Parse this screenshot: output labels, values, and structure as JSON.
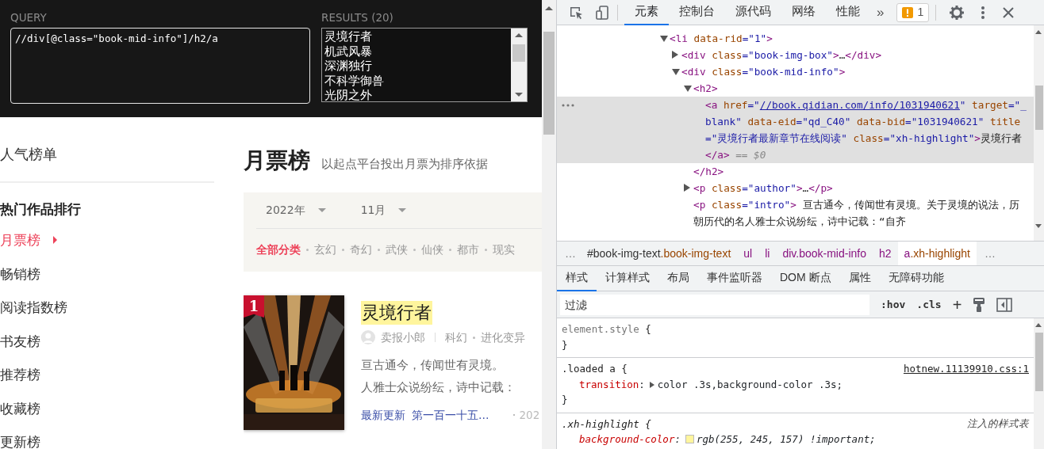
{
  "query_panel": {
    "query_label": "QUERY",
    "query": "//div[@class=\"book-mid-info\"]/h2/a",
    "results_label": "RESULTS (20)",
    "results": [
      "灵境行者",
      "机武风暴",
      "深渊独行",
      "不科学御兽",
      "光阴之外"
    ]
  },
  "page": {
    "sidebar": {
      "header": "人气榜单",
      "section_title": "热门作品排行",
      "items": [
        {
          "label": "月票榜",
          "selected": true
        },
        {
          "label": "畅销榜",
          "selected": false
        },
        {
          "label": "阅读指数榜",
          "selected": false
        },
        {
          "label": "书友榜",
          "selected": false
        },
        {
          "label": "推荐榜",
          "selected": false
        },
        {
          "label": "收藏榜",
          "selected": false
        },
        {
          "label": "更新榜",
          "selected": false
        }
      ]
    },
    "ranking": {
      "title": "月票榜",
      "subtitle": "以起点平台投出月票为排序依据",
      "year": "2022年",
      "month": "11月",
      "categories": [
        {
          "label": "全部分类",
          "selected": true
        },
        {
          "label": "玄幻",
          "selected": false
        },
        {
          "label": "奇幻",
          "selected": false
        },
        {
          "label": "武侠",
          "selected": false
        },
        {
          "label": "仙侠",
          "selected": false
        },
        {
          "label": "都市",
          "selected": false
        },
        {
          "label": "现实",
          "selected": false
        }
      ]
    },
    "book": {
      "rank": "1",
      "title": "灵境行者",
      "highlighted": true,
      "author": "卖报小郎",
      "genre": "科幻",
      "subgenre": "进化变异",
      "intro_lines": [
        "亘古通今，传闻世有灵境。",
        "人雅士众说纷纭，诗中记载："
      ],
      "latest_label": "最新更新",
      "latest_chapter": "第一百一十五…",
      "date": "202"
    }
  },
  "devtools": {
    "tabs": [
      {
        "label": "元素",
        "selected": true
      },
      {
        "label": "控制台",
        "selected": false
      },
      {
        "label": "源代码",
        "selected": false
      },
      {
        "label": "网络",
        "selected": false
      },
      {
        "label": "性能",
        "selected": false
      }
    ],
    "more": "»",
    "issues": "1",
    "dom_tree": [
      {
        "expanded": true,
        "selected": false,
        "segments": [
          {
            "kind": "tag",
            "text": "<li"
          },
          {
            "kind": "attr",
            "text": " data-rid"
          },
          {
            "kind": "val",
            "text": "=\"1\""
          },
          {
            "kind": "tag",
            "text": ">"
          }
        ],
        "children": [
          {
            "expanded": false,
            "selected": false,
            "segments": [
              {
                "kind": "tag",
                "text": "<div"
              },
              {
                "kind": "attr",
                "text": " class"
              },
              {
                "kind": "val",
                "text": "=\"book-img-box\""
              },
              {
                "kind": "tag",
                "text": ">"
              },
              {
                "kind": "text",
                "text": "…"
              },
              {
                "kind": "tag",
                "text": "</div>"
              }
            ]
          },
          {
            "expanded": true,
            "selected": false,
            "segments": [
              {
                "kind": "tag",
                "text": "<div"
              },
              {
                "kind": "attr",
                "text": " class"
              },
              {
                "kind": "val",
                "text": "=\"book-mid-info\""
              },
              {
                "kind": "tag",
                "text": ">"
              }
            ],
            "children": [
              {
                "expanded": true,
                "selected": false,
                "segments": [
                  {
                    "kind": "tag",
                    "text": "<h2>"
                  }
                ],
                "close": [
                  {
                    "kind": "tag",
                    "text": "</h2>"
                  }
                ],
                "children": [
                  {
                    "selected": true,
                    "segments": [
                      {
                        "kind": "tag",
                        "text": "<a"
                      },
                      {
                        "kind": "attr",
                        "text": " href"
                      },
                      {
                        "kind": "val",
                        "text": "=\""
                      },
                      {
                        "kind": "link",
                        "text": "//book.qidian.com/info/1031940621"
                      },
                      {
                        "kind": "val",
                        "text": "\""
                      },
                      {
                        "kind": "attr",
                        "text": " target"
                      },
                      {
                        "kind": "val",
                        "text": "=\"_blank\""
                      },
                      {
                        "kind": "attr",
                        "text": " data-eid"
                      },
                      {
                        "kind": "val",
                        "text": "=\"qd_C40\""
                      },
                      {
                        "kind": "attr",
                        "text": " data-bid"
                      },
                      {
                        "kind": "val",
                        "text": "=\"1031940621\""
                      },
                      {
                        "kind": "attr",
                        "text": " title"
                      },
                      {
                        "kind": "val",
                        "text": "=\"灵境行者最新章节在线阅读\""
                      },
                      {
                        "kind": "attr",
                        "text": " class"
                      },
                      {
                        "kind": "val",
                        "text": "=\"xh-highlight\""
                      },
                      {
                        "kind": "tag",
                        "text": ">"
                      },
                      {
                        "kind": "text",
                        "text": "灵境行者"
                      },
                      {
                        "kind": "tag",
                        "text": "</a>"
                      },
                      {
                        "kind": "hint",
                        "text": " == $0"
                      }
                    ]
                  }
                ]
              },
              {
                "expanded": false,
                "selected": false,
                "segments": [
                  {
                    "kind": "tag",
                    "text": "<p"
                  },
                  {
                    "kind": "attr",
                    "text": " class"
                  },
                  {
                    "kind": "val",
                    "text": "=\"author\""
                  },
                  {
                    "kind": "tag",
                    "text": ">"
                  },
                  {
                    "kind": "text",
                    "text": "…"
                  },
                  {
                    "kind": "tag",
                    "text": "</p>"
                  }
                ]
              },
              {
                "selected": false,
                "segments": [
                  {
                    "kind": "tag",
                    "text": "<p"
                  },
                  {
                    "kind": "attr",
                    "text": " class"
                  },
                  {
                    "kind": "val",
                    "text": "=\"intro\""
                  },
                  {
                    "kind": "tag",
                    "text": ">"
                  },
                  {
                    "kind": "text",
                    "text": " 亘古通今，传闻世有灵境。关于灵境的说法，历朝历代的名人雅士众说纷纭，诗中记载：“自齐"
                  }
                ]
              }
            ]
          }
        ]
      }
    ],
    "breadcrumb": {
      "leading": "…",
      "trailing": "…",
      "items": [
        {
          "selected": false,
          "parts": [
            {
              "kind": "id",
              "text": "#book-img-text"
            },
            {
              "kind": "cls",
              "text": ".book-img-text"
            }
          ]
        },
        {
          "selected": false,
          "parts": [
            {
              "kind": "tag",
              "text": "ul"
            }
          ]
        },
        {
          "selected": false,
          "parts": [
            {
              "kind": "tag",
              "text": "li"
            }
          ]
        },
        {
          "selected": false,
          "parts": [
            {
              "kind": "tag",
              "text": "div.book-mid-info"
            }
          ]
        },
        {
          "selected": false,
          "parts": [
            {
              "kind": "tag",
              "text": "h2"
            }
          ]
        },
        {
          "selected": true,
          "parts": [
            {
              "kind": "tag",
              "text": "a"
            },
            {
              "kind": "cls",
              "text": ".xh-highlight"
            }
          ]
        }
      ]
    },
    "styles_tabs": [
      {
        "label": "样式",
        "selected": true
      },
      {
        "label": "计算样式",
        "selected": false
      },
      {
        "label": "布局",
        "selected": false
      },
      {
        "label": "事件监听器",
        "selected": false
      },
      {
        "label": "DOM 断点",
        "selected": false
      },
      {
        "label": "属性",
        "selected": false
      },
      {
        "label": "无障碍功能",
        "selected": false
      }
    ],
    "filter": {
      "placeholder": "过滤",
      "hov": ":hov",
      "cls": ".cls",
      "add": "+"
    },
    "rules": [
      {
        "selector": "element.style",
        "kind": "inline",
        "open": "{",
        "close": "}"
      },
      {
        "selector": ".loaded a",
        "kind": "stylesheet",
        "source": "hotnew.11139910.css:1",
        "open": "{",
        "close": "}",
        "declarations": [
          {
            "property": "transition",
            "colon": ":",
            "value": "color .3s,background-color .3s",
            "end": ";",
            "expandable": true
          }
        ]
      },
      {
        "selector": ".xh-highlight",
        "kind": "injected",
        "source": "注入的样式表",
        "open": "{",
        "declarations": [
          {
            "property": "background-color",
            "colon": ":",
            "value": "rgb(255, 245, 157) !important",
            "end": ";",
            "color": "#fff59d"
          }
        ]
      }
    ]
  }
}
